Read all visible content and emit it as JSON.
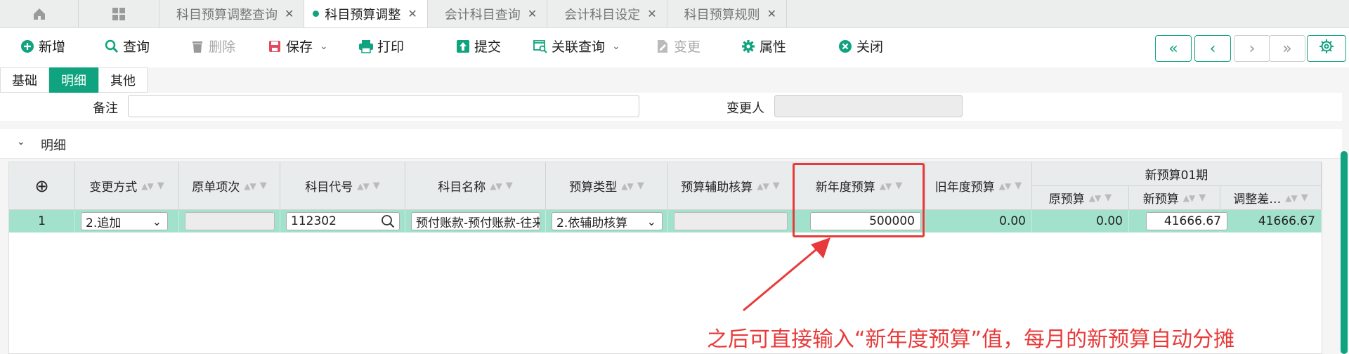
{
  "tabs": [
    {
      "label": "科目预算调整查询"
    },
    {
      "label": "科目预算调整"
    },
    {
      "label": "会计科目查询"
    },
    {
      "label": "会计科目设定"
    },
    {
      "label": "科目预算规则"
    }
  ],
  "tab_close": "✕",
  "toolbar": {
    "add": "新增",
    "query": "查询",
    "delete": "删除",
    "save": "保存",
    "print": "打印",
    "submit": "提交",
    "related_query": "关联查询",
    "change": "变更",
    "properties": "属性",
    "close": "关闭"
  },
  "subtabs": [
    "基础",
    "明细",
    "其他"
  ],
  "form": {
    "remark_label": "备注",
    "remark_value": "",
    "changer_label": "变更人",
    "changer_value": ""
  },
  "section": {
    "title": "明细"
  },
  "grid": {
    "columns": {
      "add": "⊕",
      "change_mode": "变更方式",
      "orig_seq": "原单项次",
      "account_code": "科目代号",
      "account_name": "科目名称",
      "budget_type": "预算类型",
      "aux": "预算辅助核算",
      "new_year": "新年度预算",
      "old_year": "旧年度预算",
      "period_group": "新预算01期",
      "orig_budget": "原预算",
      "new_budget": "新预算",
      "adjust_diff": "调整差…"
    },
    "row": {
      "index": "1",
      "change_mode": "2.追加",
      "orig_seq": "",
      "account_code": "112302",
      "account_name": "预付账款-预付账款-往来",
      "budget_type": "2.依辅助核算",
      "aux": "",
      "new_year": "500000",
      "old_year": "0.00",
      "orig_budget": "0.00",
      "new_budget": "41666.67",
      "adjust_diff": "41666.67"
    }
  },
  "annotation": "之后可直接输入“新年度预算”值，每月的新预算自动分摊",
  "colors": {
    "accent": "#10a37f",
    "row_highlight": "#a2e2cc",
    "annotation": "#e83a3a"
  }
}
